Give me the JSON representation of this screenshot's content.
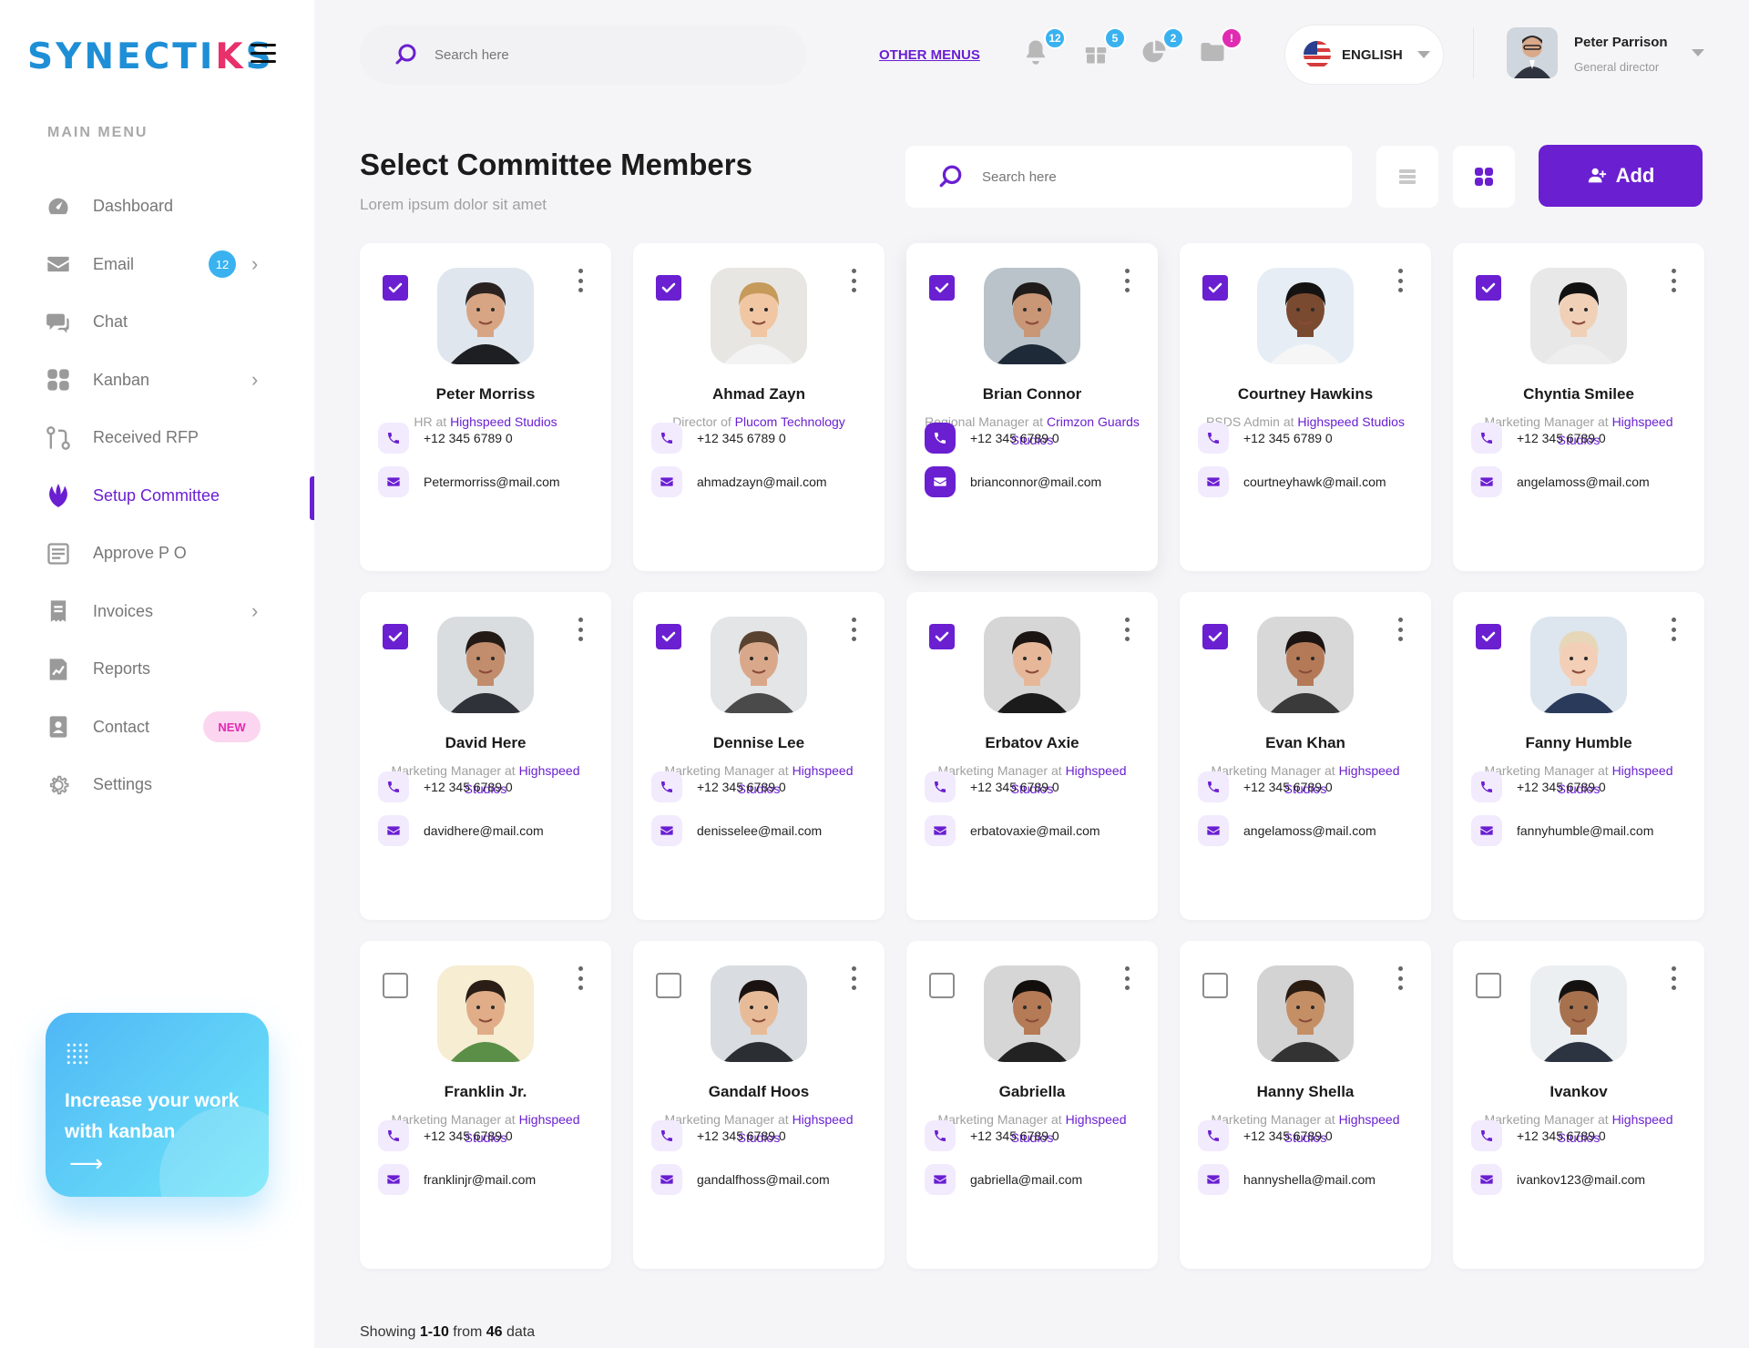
{
  "app": {
    "logo_pre": "SYNECTI",
    "logo_k": "K",
    "logo_post": "S"
  },
  "sidebar": {
    "menu_title": "MAIN MENU",
    "items": [
      {
        "label": "Dashboard",
        "icon": "dashboard-icon"
      },
      {
        "label": "Email",
        "icon": "email-icon",
        "badge": "12"
      },
      {
        "label": "Chat",
        "icon": "chat-icon"
      },
      {
        "label": "Kanban",
        "icon": "kanban-icon"
      },
      {
        "label": "Received RFP",
        "icon": "rfp-icon"
      },
      {
        "label": "Setup Committee",
        "icon": "committee-icon",
        "active": true
      },
      {
        "label": "Approve P O",
        "icon": "approve-icon"
      },
      {
        "label": "Invoices",
        "icon": "invoice-icon"
      },
      {
        "label": "Reports",
        "icon": "reports-icon"
      },
      {
        "label": "Contact",
        "icon": "contact-icon",
        "pill": "NEW"
      },
      {
        "label": "Settings",
        "icon": "settings-icon"
      }
    ],
    "promo": {
      "text": "Increase your work with kanban",
      "arrow": "⟶"
    }
  },
  "header": {
    "search_placeholder": "Search here",
    "other_menus": "OTHER MENUS",
    "badges": {
      "bell": "12",
      "gift": "5",
      "chart": "2",
      "folder": "!"
    },
    "language": "ENGLISH",
    "user": {
      "name": "Peter Parrison",
      "role": "General director"
    }
  },
  "page": {
    "title": "Select Committee Members",
    "subtitle": "Lorem ipsum  dolor sit amet",
    "search_placeholder": "Search here",
    "add_label": "Add",
    "showing_pre": "Showing ",
    "showing_range": "1-10",
    "showing_mid": " from ",
    "showing_total": "46",
    "showing_post": " data"
  },
  "members": [
    {
      "name": "Peter Morriss",
      "role": "HR at ",
      "company": "Highspeed Studios",
      "phone": "+12 345 6789 0",
      "email": "Petermorriss@mail.com",
      "checked": true
    },
    {
      "name": "Ahmad Zayn",
      "role": "Director of ",
      "company": "Plucom Technology",
      "phone": "+12 345 6789 0",
      "email": "ahmadzayn@mail.com",
      "checked": true
    },
    {
      "name": "Brian Connor",
      "role": "Regional Manager  at ",
      "company": "Crimzon Guards Studios",
      "phone": "+12 345 6789 0",
      "email": "brianconnor@mail.com",
      "checked": true,
      "highlight": true
    },
    {
      "name": "Courtney Hawkins",
      "role": "PSDS Admin at ",
      "company": "Highspeed Studios",
      "phone": "+12 345 6789 0",
      "email": "courtneyhawk@mail.com",
      "checked": true
    },
    {
      "name": "Chyntia Smilee",
      "role": "Marketing Manager at ",
      "company": "Highspeed Studios",
      "phone": "+12 345 6789 0",
      "email": "angelamoss@mail.com",
      "checked": true
    },
    {
      "name": "David Here",
      "role": "Marketing Manager at ",
      "company": "Highspeed Studios",
      "phone": "+12 345 6789 0",
      "email": "davidhere@mail.com",
      "checked": true
    },
    {
      "name": "Dennise Lee",
      "role": "Marketing Manager at ",
      "company": "Highspeed Studios",
      "phone": "+12 345 6789 0",
      "email": "denisselee@mail.com",
      "checked": true
    },
    {
      "name": "Erbatov Axie",
      "role": "Marketing Manager at ",
      "company": "Highspeed Studios",
      "phone": "+12 345 6789 0",
      "email": "erbatovaxie@mail.com",
      "checked": true
    },
    {
      "name": "Evan Khan",
      "role": "Marketing Manager at ",
      "company": "Highspeed Studios",
      "phone": "+12 345 6789 0",
      "email": "angelamoss@mail.com",
      "checked": true
    },
    {
      "name": "Fanny Humble",
      "role": "Marketing Manager at ",
      "company": "Highspeed Studios",
      "phone": "+12 345 6789 0",
      "email": "fannyhumble@mail.com",
      "checked": true
    },
    {
      "name": "Franklin Jr.",
      "role": "Marketing Manager at ",
      "company": "Highspeed Studios",
      "phone": "+12 345 6789 0",
      "email": "franklinjr@mail.com",
      "checked": false
    },
    {
      "name": "Gandalf Hoos",
      "role": "Marketing Manager at ",
      "company": "Highspeed Studios",
      "phone": "+12 345 6789 0",
      "email": "gandalfhoss@mail.com",
      "checked": false
    },
    {
      "name": "Gabriella",
      "role": "Marketing Manager at ",
      "company": "Highspeed Studios",
      "phone": "+12 345 6789 0",
      "email": "gabriella@mail.com",
      "checked": false
    },
    {
      "name": "Hanny Shella",
      "role": "Marketing Manager at ",
      "company": "Highspeed Studios",
      "phone": "+12 345 6789 0",
      "email": "hannyshella@mail.com",
      "checked": false
    },
    {
      "name": "Ivankov",
      "role": "Marketing Manager at ",
      "company": "Highspeed Studios",
      "phone": "+12 345 6789 0",
      "email": "ivankov123@mail.com",
      "checked": false
    }
  ],
  "colors": {
    "accent": "#6a1fd1",
    "badge_blue": "#3ab2f0",
    "badge_pink": "#e12bb2",
    "brand_blue": "#1e8fd6",
    "brand_pink": "#e8306a"
  }
}
